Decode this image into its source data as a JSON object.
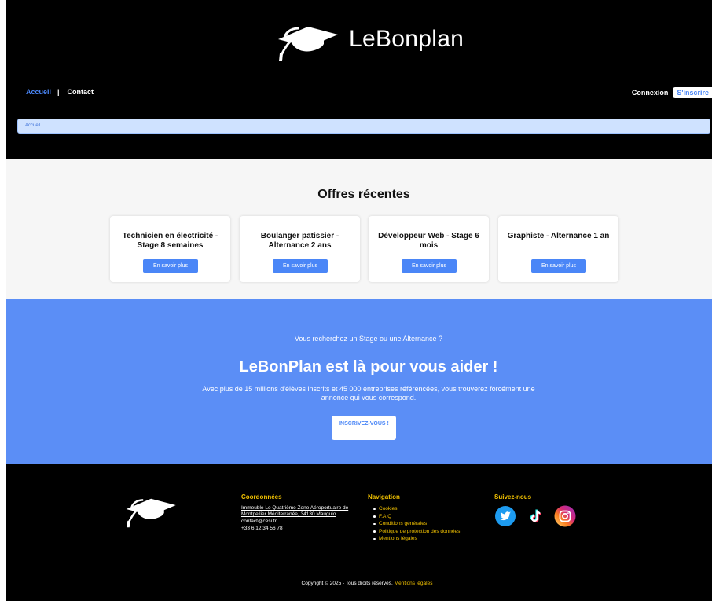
{
  "header": {
    "brand_name": "LeBonplan",
    "nav": {
      "home": "Accueil",
      "separator": "|",
      "contact": "Contact"
    },
    "auth": {
      "login": "Connexion",
      "signup": "S'inscrire"
    },
    "breadcrumb": "Accueil"
  },
  "offers": {
    "title": "Offres récentes",
    "cards": [
      {
        "title": "Technicien en électricité - Stage 8 semaines",
        "button": "En savoir plus"
      },
      {
        "title": "Boulanger patissier - Alternance 2 ans",
        "button": "En savoir plus"
      },
      {
        "title": "Développeur Web - Stage 6 mois",
        "button": "En savoir plus"
      },
      {
        "title": "Graphiste - Alternance 1 an",
        "button": "En savoir plus"
      }
    ]
  },
  "hero": {
    "question": "Vous recherchez un Stage ou une Alternance ?",
    "title": "LeBonPlan est là pour vous aider !",
    "description": "Avec plus de 15 millions d'élèves inscrits et 45 000 entreprises référencées, vous trouverez forcément une annonce qui vous correspond.",
    "cta": "INSCRIVEZ-VOUS !"
  },
  "footer": {
    "coords": {
      "title": "Coordonnées",
      "address": "Immeuble Le Quatrième Zone Aéroportuaire de Montpellier Méditerranée, 34130 Mauguio",
      "email": "contact@cesi.fr",
      "phone": "+33 6 12 34 56 78"
    },
    "navigation": {
      "title": "Navigation",
      "links": [
        "Cookies",
        "F.A.Q",
        "Conditions générales",
        "Politique de protection des données",
        "Mentions légales"
      ]
    },
    "social": {
      "title": "Suivez-nous",
      "icons": [
        "twitter-icon",
        "tiktok-icon",
        "instagram-icon"
      ]
    },
    "copyright": "Copyright © 2025 - Tous droits réservés.",
    "copyright_link": "Mentions légales"
  },
  "colors": {
    "accent": "#4a86f7",
    "hero_bg": "#5b8ef6",
    "footer_heading": "#f2c200",
    "breadcrumb_bg": "#cfe2ff"
  }
}
